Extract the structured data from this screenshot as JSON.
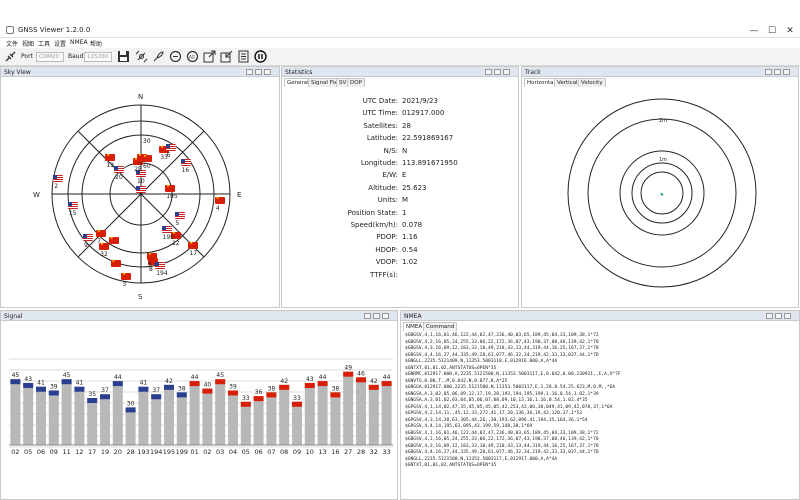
{
  "window": {
    "title": "GNSS Viewer 1.2.0.0",
    "controls": [
      "—",
      "☐",
      "✕"
    ]
  },
  "menu": [
    "文件",
    "视图",
    "工具",
    "设置",
    "NMEA",
    "帮助"
  ],
  "toolbar": {
    "port_label": "Port",
    "port_value": "COM20",
    "baud_label": "Baud",
    "baud_value": "115200"
  },
  "sky_view": {
    "title": "Sky View",
    "directions": {
      "n": "N",
      "e": "E",
      "s": "S",
      "w": "W"
    },
    "rings": [
      "30",
      "60"
    ],
    "satellites": [
      {
        "id": "",
        "country": "us",
        "az": 0,
        "el": 86
      },
      {
        "id": "10",
        "country": "us",
        "az": 0,
        "el": 70
      },
      {
        "id": "28",
        "country": "cn",
        "az": 355,
        "el": 58
      },
      {
        "id": "3",
        "country": "cn",
        "az": 2,
        "el": 54
      },
      {
        "id": "",
        "country": "cn",
        "az": 10,
        "el": 54
      },
      {
        "id": "33",
        "country": "cn",
        "az": 28,
        "el": 40
      },
      {
        "id": "6",
        "country": "us",
        "az": 33,
        "el": 35
      },
      {
        "id": "13",
        "country": "cn",
        "az": 320,
        "el": 42
      },
      {
        "id": "20",
        "country": "us",
        "az": 318,
        "el": 57
      },
      {
        "id": "195",
        "country": "cn",
        "az": 80,
        "el": 60
      },
      {
        "id": "5",
        "country": "us",
        "az": 120,
        "el": 45
      },
      {
        "id": "12",
        "country": "cn",
        "az": 140,
        "el": 35
      },
      {
        "id": "16",
        "country": "us",
        "az": 55,
        "el": 35
      },
      {
        "id": "4",
        "country": "cn",
        "az": 95,
        "el": 10
      },
      {
        "id": "199",
        "country": "us",
        "az": 145,
        "el": 45
      },
      {
        "id": "17",
        "country": "cn",
        "az": 135,
        "el": 15
      },
      {
        "id": "2",
        "country": "us",
        "az": 280,
        "el": 5
      },
      {
        "id": "15",
        "country": "us",
        "az": 260,
        "el": 20
      },
      {
        "id": "9",
        "country": "us",
        "az": 230,
        "el": 20
      },
      {
        "id": "7",
        "country": "cn",
        "az": 225,
        "el": 33
      },
      {
        "id": "32",
        "country": "cn",
        "az": 215,
        "el": 25
      },
      {
        "id": "",
        "country": "cn",
        "az": 210,
        "el": 35
      },
      {
        "id": "",
        "country": "cn",
        "az": 200,
        "el": 15
      },
      {
        "id": "3",
        "country": "cn",
        "az": 190,
        "el": 5
      },
      {
        "id": "8",
        "country": "cn",
        "az": 170,
        "el": 20
      },
      {
        "id": "194",
        "country": "us",
        "az": 165,
        "el": 15
      },
      {
        "id": "6",
        "country": "cn",
        "az": 170,
        "el": 25
      }
    ]
  },
  "statistics": {
    "title": "Statistics",
    "tabs": [
      "General",
      "Signal Fix",
      "SV",
      "DOP"
    ],
    "rows": [
      {
        "label": "UTC Date:",
        "value": "2021/9/23"
      },
      {
        "label": "UTC Time:",
        "value": "012917.000"
      },
      {
        "label": "Satellites:",
        "value": "28"
      },
      {
        "label": "Latitude:",
        "value": "22.591869167"
      },
      {
        "label": "N/S:",
        "value": "N"
      },
      {
        "label": "Longitude:",
        "value": "113.891671950"
      },
      {
        "label": "E/W:",
        "value": "E"
      },
      {
        "label": "Altitude:",
        "value": "25.623"
      },
      {
        "label": "Units:",
        "value": "M"
      },
      {
        "label": "Position State:",
        "value": "1"
      },
      {
        "label": "Speed(km/h):",
        "value": "0.078"
      },
      {
        "label": "PDOP:",
        "value": "1.16"
      },
      {
        "label": "HDOP:",
        "value": "0.54"
      },
      {
        "label": "VDOP:",
        "value": "1.02"
      },
      {
        "label": "TTFF(s):",
        "value": ""
      }
    ]
  },
  "track": {
    "title": "Track",
    "tabs": [
      "Horizontal",
      "Vertical",
      "Velocity"
    ],
    "ring_labels": [
      "2m",
      "1m"
    ]
  },
  "signal": {
    "title": "Signal"
  },
  "nmea": {
    "title": "NMEA",
    "tabs": [
      "NMEA",
      "Command"
    ],
    "lines": [
      "$GBGSV,4,1,16,01,46,122,44,02,47,236,40,03,65,189,45,04,33,109,38,1*72",
      "$GBGSV,4,2,16,05,24,255,33,06,22,172,36,07,43,190,37,08,46,139,42,1*70",
      "$GBGSV,4,3,16,09,12,183,33,10,49,218,43,13,44,319,44,16,25,167,37,1*78",
      "$GBGSV,4,4,16,27,44,335,49,28,61,077,46,32,34,219,42,33,33,037,44,1*7D",
      "$GNGLL,2235.5121409,N,11353.5003118,E,012916.000,A,A*4A",
      "$GNTXT,01,01,02,ANTSTATUS=OPEN*35",
      "$GNRMC,012917.000,A,2235.5121500,N,11353.5003117,E,0.042,0.00,230921,,E,A,V*7F",
      "$GNVTG,0.00,T,,M,0.042,N,0.077,K,A*25",
      "$GNGGA,012917.000,2235.5121500,N,11353.5003117,E,1,28,0.54,25.623,M,0.M,,*6A",
      "$GNGSA,A,3,02,05,06,09,12,17,19,20,193,194,195,199,1.16,0.54,1.02,1*39",
      "$GNGSA,A,3,01,02,03,04,05,06,07,08,09,10,13,16,1.16,0.54,1.02,4*35",
      "$GPGSV,4,1,14,02,47,35,45,05,45,05,42,253,43,06,38,049,41,09,42,070,37,1*6A",
      "$GPGSV,4,2,14,11,,45,12,33,272,41,17,20,136,36,19,42,120,37,1*53",
      "$GPGSV,4,3,14,20,63,305,44,26,,30,193,62,096,41,194,35,164,36,1*54",
      "$GPGSV,4,4,14,195,63,095,43,199,59,148,38,1*69",
      "$GBGSV,4,1,16,01,46,122,44,02,47,236,40,03,65,189,45,04,33,109,38,1*72",
      "$GBGSV,4,2,16,05,24,255,33,06,22,172,36,07,43,190,37,08,46,139,42,1*70",
      "$GBGSV,4,3,16,09,12,183,33,10,49,218,43,13,44,319,44,16,25,167,37,1*78",
      "$GBGSV,4,4,16,27,44,335,49,28,61,077,46,32,34,219,42,33,33,037,44,1*7D",
      "$GNGLL,2235.5121500,N,11353.5003117,E,012917.000,A,A*4A",
      "$GNTXT,01,01,02,ANTSTATUS=OPEN*35"
    ]
  },
  "chart_data": {
    "type": "bar",
    "categories": [
      "02",
      "05",
      "06",
      "09",
      "11",
      "12",
      "17",
      "19",
      "20",
      "28",
      "193",
      "194",
      "195",
      "199",
      "01",
      "02",
      "03",
      "04",
      "05",
      "06",
      "07",
      "08",
      "09",
      "10",
      "13",
      "16",
      "27",
      "28",
      "32",
      "33"
    ],
    "values": [
      45,
      43,
      41,
      39,
      45,
      41,
      35,
      37,
      44,
      30,
      41,
      37,
      42,
      38,
      44,
      40,
      45,
      39,
      33,
      36,
      38,
      42,
      33,
      43,
      44,
      38,
      49,
      46,
      42,
      44
    ],
    "countries": [
      "us",
      "us",
      "us",
      "us",
      "us",
      "us",
      "us",
      "us",
      "us",
      "us",
      "us",
      "us",
      "us",
      "us",
      "cn",
      "cn",
      "cn",
      "cn",
      "cn",
      "cn",
      "cn",
      "cn",
      "cn",
      "cn",
      "cn",
      "cn",
      "cn",
      "cn",
      "cn",
      "cn"
    ],
    "ylim": [
      0,
      60
    ],
    "grid": true,
    "colors": {
      "bar": "#b8b8b8",
      "us_cap": "#2a3f8f",
      "cn_cap": "#d81e06"
    }
  }
}
